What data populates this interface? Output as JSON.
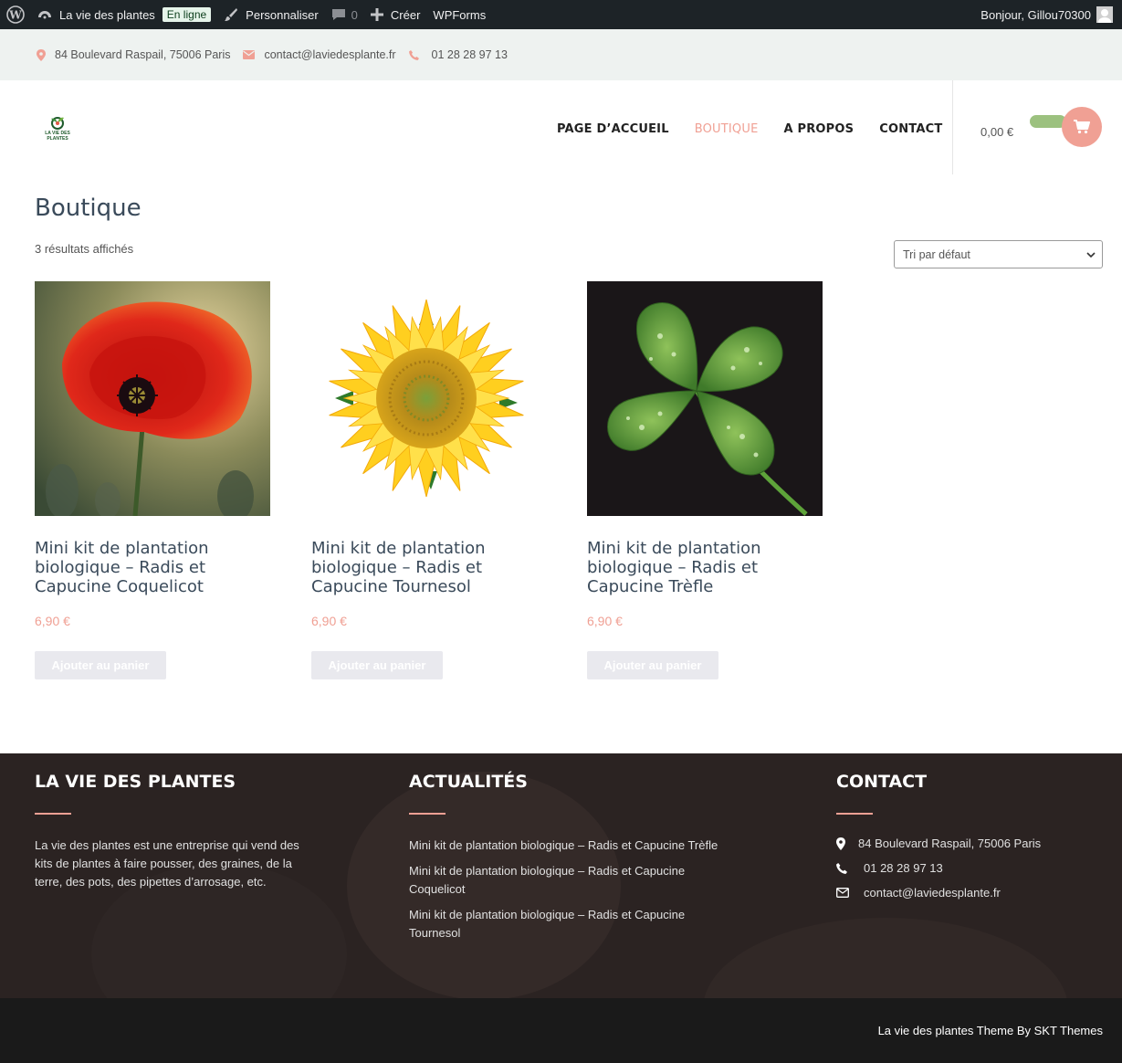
{
  "adminbar": {
    "site_name": "La vie des plantes",
    "status_badge": "En ligne",
    "customize": "Personnaliser",
    "comments_count": "0",
    "create": "Créer",
    "wpforms": "WPForms",
    "greeting": "Bonjour, Gillou70300"
  },
  "topbar": {
    "address": "84 Boulevard Raspail, 75006 Paris",
    "email": "contact@laviedesplante.fr",
    "phone": "01 28 28 97 13"
  },
  "header": {
    "logo_text": "LA VIE DES PLANTES",
    "nav": [
      {
        "label": "PAGE D’ACCUEIL"
      },
      {
        "label": "BOUTIQUE"
      },
      {
        "label": "A PROPOS"
      },
      {
        "label": "CONTACT"
      }
    ],
    "cart_total": "0,00 €"
  },
  "shop": {
    "title": "Boutique",
    "result_count": "3 résultats affichés",
    "sort_selected": "Tri par défaut",
    "products": [
      {
        "title": "Mini kit de plantation biologique – Radis et Capucine Coquelicot",
        "price": "6,90 €",
        "button": "Ajouter au panier"
      },
      {
        "title": "Mini kit de plantation biologique – Radis et Capucine Tournesol",
        "price": "6,90 €",
        "button": "Ajouter au panier"
      },
      {
        "title": "Mini kit de plantation biologique – Radis et Capucine Trèfle",
        "price": "6,90 €",
        "button": "Ajouter au panier"
      }
    ]
  },
  "footer": {
    "about_heading": "LA VIE DES PLANTES",
    "about_text": "La vie des plantes est une entreprise qui vend des kits de plantes à faire pousser, des graines, de la terre, des pots, des pipettes d’arrosage, etc.",
    "news_heading": "ACTUALITÉS",
    "news": [
      "Mini kit de plantation biologique – Radis et Capucine Trèfle",
      "Mini kit de plantation biologique – Radis et Capucine Coquelicot",
      "Mini kit de plantation biologique – Radis et Capucine Tournesol"
    ],
    "contact_heading": "CONTACT",
    "contact_address": "84 Boulevard Raspail, 75006 Paris",
    "contact_phone": "01 28 28 97 13",
    "contact_email": "contact@laviedesplante.fr",
    "credits": "La vie des plantes Theme By SKT Themes"
  },
  "colors": {
    "accent": "#f0a094",
    "admin_bar": "#1d2327",
    "footer": "#2b2322",
    "cart_pill": "#9cc17f"
  }
}
